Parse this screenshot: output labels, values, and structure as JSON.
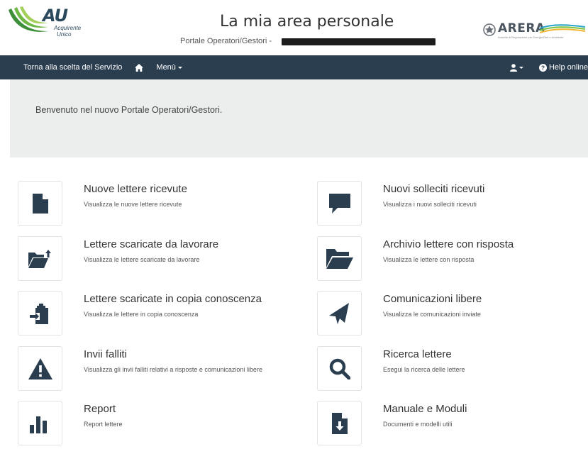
{
  "header": {
    "logo_au": {
      "main": "AU",
      "line1": "Acquirente",
      "line2": "Unico",
      "icon": "au-swoosh-logo"
    },
    "title": "La mia area personale",
    "subtitle": "Portale Operatori/Gestori -",
    "logo_arera": {
      "main": "ARERA",
      "tagline": "Autorità di Regolazione per Energia Reti e Ambiente",
      "icon": "arera-emblem"
    }
  },
  "navbar": {
    "back_label": "Torna alla scelta del Servizio",
    "home_icon": "home-icon",
    "menu_label": "Menù",
    "user_icon": "user-icon",
    "help_label": "Help online",
    "bg_color": "#2b3e50"
  },
  "banner": {
    "text": "Benvenuto nel nuovo Portale Operatori/Gestori."
  },
  "tiles": [
    {
      "title": "Nuove lettere ricevute",
      "desc": "Visualizza le nuove lettere ricevute",
      "icon": "file-icon"
    },
    {
      "title": "Nuovi solleciti ricevuti",
      "desc": "Visualizza i nuovi solleciti ricevuti",
      "icon": "comment-icon"
    },
    {
      "title": "Lettere scaricate da lavorare",
      "desc": "Visualizza le lettere scaricate da lavorare",
      "icon": "folder-upload-icon"
    },
    {
      "title": "Archivio lettere con risposta",
      "desc": "Visualizza le lettere con risposta",
      "icon": "folder-open-icon"
    },
    {
      "title": "Lettere scaricate in copia conoscenza",
      "desc": "Visualizza le lettere in copia conoscenza",
      "icon": "clipboard-arrow-icon"
    },
    {
      "title": "Comunicazioni libere",
      "desc": "Visualizza le comunicazioni inviate",
      "icon": "send-icon"
    },
    {
      "title": "Invii falliti",
      "desc": "Visualizza gli invii falliti relativi a risposte e comunicazioni libere",
      "icon": "warning-icon"
    },
    {
      "title": "Ricerca lettere",
      "desc": "Esegui la ricerca delle lettere",
      "icon": "search-icon"
    },
    {
      "title": "Report",
      "desc": "Report lettere",
      "icon": "bar-chart-icon"
    },
    {
      "title": "Manuale e Moduli",
      "desc": "Documenti e modelli utili",
      "icon": "file-download-icon"
    }
  ],
  "colors": {
    "navbar": "#2b3e50",
    "banner": "#eceded",
    "icon": "#2b3e50",
    "au_green": "#4aa03f"
  }
}
